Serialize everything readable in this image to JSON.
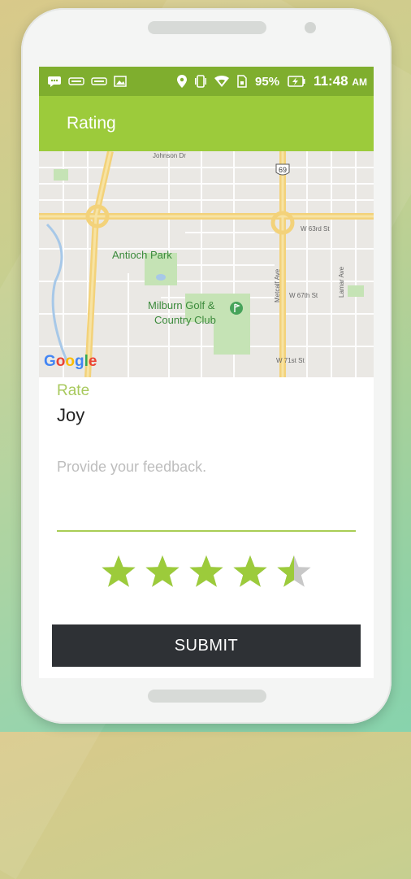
{
  "status_bar": {
    "battery": "95%",
    "time": "11:48",
    "ampm": "AM"
  },
  "app_bar": {
    "title": "Rating"
  },
  "map": {
    "labels": {
      "park": "Antioch Park",
      "golf_line1": "Milburn Golf &",
      "golf_line2": "Country Club",
      "johnson": "Johnson Dr",
      "w63": "W 63rd St",
      "w67": "W 67th St",
      "w71": "W 71st St",
      "metcalf": "Metcalf Ave",
      "lamar": "Lamar Ave",
      "highway": "69"
    },
    "logo": "Google"
  },
  "form": {
    "rate_label": "Rate",
    "rated_name": "Joy",
    "feedback_placeholder": "Provide your feedback.",
    "rating": 4.5,
    "max_rating": 5,
    "submit_label": "SUBMIT"
  },
  "colors": {
    "status_bar": "#7fae2e",
    "app_bar": "#9ccb3b",
    "accent": "#a8c95d",
    "star_fill": "#9ccb3b",
    "star_empty": "#c8c8c8",
    "submit_bg": "#2e3135"
  }
}
